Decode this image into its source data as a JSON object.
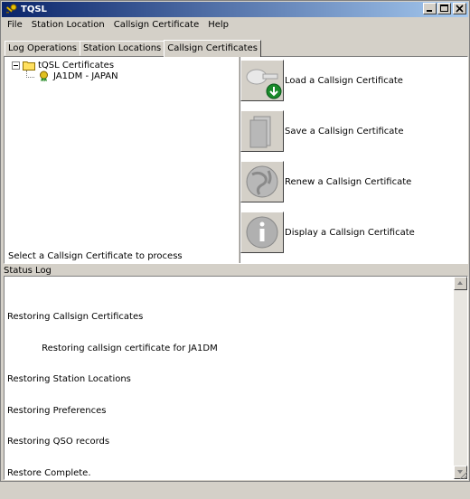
{
  "window": {
    "title": "TQSL"
  },
  "menu": {
    "items": [
      "File",
      "Station Location",
      "Callsign Certificate",
      "Help"
    ]
  },
  "tabs": [
    {
      "label": "Log Operations",
      "active": false
    },
    {
      "label": "Station Locations",
      "active": false
    },
    {
      "label": "Callsign Certificates",
      "active": true
    }
  ],
  "tree": {
    "root_label": "tQSL Certificates",
    "child_label": "JA1DM - JAPAN"
  },
  "hint": "Select a Callsign Certificate to process",
  "actions": [
    {
      "label": "Load a Callsign Certificate",
      "icon": "load-icon"
    },
    {
      "label": "Save a Callsign Certificate",
      "icon": "save-icon"
    },
    {
      "label": "Renew a Callsign Certificate",
      "icon": "renew-icon"
    },
    {
      "label": "Display a Callsign Certificate",
      "icon": "info-icon"
    }
  ],
  "status_log": {
    "label": "Status Log",
    "lines": [
      "Restoring Callsign Certificates",
      "            Restoring callsign certificate for JA1DM",
      "Restoring Station Locations",
      "Restoring Preferences",
      "Restoring QSO records",
      "Restore Complete."
    ]
  },
  "colors": {
    "titlebar_start": "#0a246a",
    "titlebar_end": "#a6caf0",
    "face": "#d4d0c8",
    "accent_green": "#1a8a2a"
  }
}
